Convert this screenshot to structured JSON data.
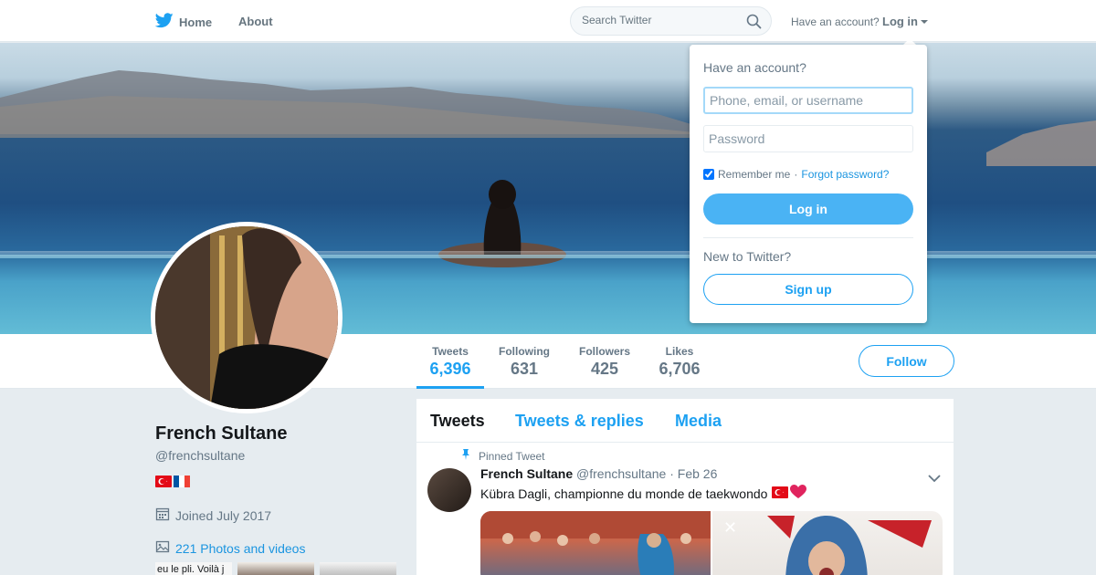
{
  "nav": {
    "home_label": "Home",
    "about_label": "About",
    "search_placeholder": "Search Twitter",
    "account_prompt": "Have an account?",
    "login_label": "Log in"
  },
  "profile": {
    "name": "French Sultane",
    "handle": "@frenchsultane",
    "joined": "Joined July 2017",
    "photos_link": "221 Photos and videos",
    "thumb_text": "eu le pli. Voilà j",
    "follow_label": "Follow"
  },
  "stats": [
    {
      "label": "Tweets",
      "value": "6,396",
      "active": true
    },
    {
      "label": "Following",
      "value": "631",
      "active": false
    },
    {
      "label": "Followers",
      "value": "425",
      "active": false
    },
    {
      "label": "Likes",
      "value": "6,706",
      "active": false
    }
  ],
  "timeline": {
    "tabs": [
      "Tweets",
      "Tweets & replies",
      "Media"
    ],
    "pinned_label": "Pinned Tweet",
    "tweet": {
      "author": "French Sultane",
      "handle": "@frenchsultane",
      "separator": "·",
      "date": "Feb 26",
      "text": "Kübra Dagli, championne du monde de taekwondo"
    }
  },
  "login_dropdown": {
    "title": "Have an account?",
    "username_placeholder": "Phone, email, or username",
    "password_placeholder": "Password",
    "remember_label": "Remember me",
    "separator": "·",
    "forgot_label": "Forgot password?",
    "login_button": "Log in",
    "new_prompt": "New to Twitter?",
    "signup_button": "Sign up"
  },
  "colors": {
    "accent": "#1da1f2",
    "login_button_bg": "#4ab3f4",
    "text_muted": "#657786",
    "page_bg": "#e6ecf0"
  },
  "icons": {
    "logo": "twitter-bird-icon",
    "search": "search-icon",
    "calendar": "calendar-icon",
    "photo": "photo-icon",
    "pin": "pin-icon",
    "chevron": "chevron-down-icon",
    "flags": [
      "turkey-flag-icon",
      "france-flag-icon"
    ],
    "emoji": [
      "turkey-flag-icon",
      "red-heart-icon"
    ]
  }
}
